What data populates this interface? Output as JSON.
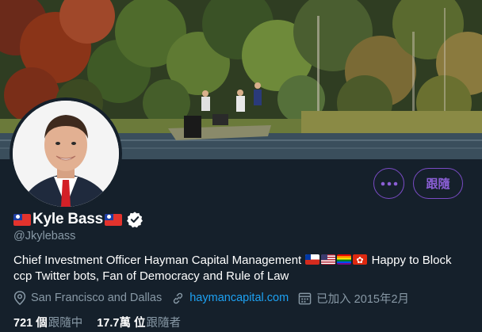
{
  "profile": {
    "display_name": "Kyle Bass",
    "handle": "@Jkylebass",
    "name_prefix_icon": "taiwan-flag-icon",
    "name_suffix_icon": "taiwan-flag-icon",
    "verified_icon": "verified-badge-icon",
    "bio_part1": "Chief Investment Officer Hayman Capital Management",
    "bio_flags": [
      "chile-flag-icon",
      "us-flag-icon",
      "rainbow-flag-icon",
      "hong-kong-flag-icon"
    ],
    "bio_part2": "Happy to Block ccp Twitter bots, Fan of Democracy and Rule of Law",
    "location": "San Francisco and Dallas",
    "website": "haymancapital.com",
    "joined": "已加入 2015年2月"
  },
  "counts": {
    "following_num": "721 個",
    "following_label": "跟隨中",
    "followers_num": "17.7萬 位",
    "followers_label": "跟隨者"
  },
  "actions": {
    "more_icon": "more-dots-icon",
    "follow_label": "跟隨"
  },
  "colors": {
    "background": "#15202b",
    "accent": "#794bc4",
    "link": "#1da1f2",
    "secondary_text": "#8899a6"
  }
}
